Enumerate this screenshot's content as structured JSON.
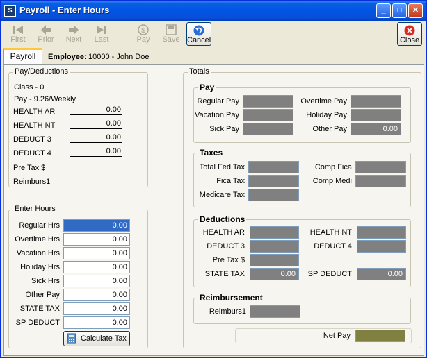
{
  "window": {
    "title": "Payroll - Enter Hours",
    "minimize": "_",
    "maximize": "□",
    "close": "✕"
  },
  "toolbar": {
    "first": "First",
    "prior": "Prior",
    "next": "Next",
    "last": "Last",
    "pay": "Pay",
    "save": "Save",
    "cancel": "Cancel",
    "close": "Close"
  },
  "tab": {
    "label": "Payroll"
  },
  "employee": {
    "label": "Employee:",
    "value": "10000 - John Doe"
  },
  "pay_deductions": {
    "title": "Pay/Deductions",
    "class": "Class - 0",
    "pay": "Pay - 9.26/Weekly",
    "rows": [
      {
        "label": "HEALTH AR",
        "value": "0.00"
      },
      {
        "label": "HEALTH NT",
        "value": "0.00"
      },
      {
        "label": "DEDUCT 3",
        "value": "0.00"
      },
      {
        "label": "DEDUCT 4",
        "value": "0.00"
      },
      {
        "label": "Pre Tax $",
        "value": ""
      },
      {
        "label": "Reimburs1",
        "value": ""
      }
    ]
  },
  "enter_hours": {
    "title": "Enter Hours",
    "rows": [
      {
        "label": "Regular Hrs",
        "value": "0.00"
      },
      {
        "label": "Overtime Hrs",
        "value": "0.00"
      },
      {
        "label": "Vacation Hrs",
        "value": "0.00"
      },
      {
        "label": "Holiday Hrs",
        "value": "0.00"
      },
      {
        "label": "Sick Hrs",
        "value": "0.00"
      },
      {
        "label": "Other Pay",
        "value": "0.00"
      },
      {
        "label": "STATE TAX",
        "value": "0.00"
      },
      {
        "label": "SP DEDUCT",
        "value": "0.00"
      }
    ],
    "calculate_label": "Calculate Tax"
  },
  "totals": {
    "title": "Totals",
    "pay": {
      "title": "Pay",
      "regular": {
        "label": "Regular Pay",
        "value": ""
      },
      "vacation": {
        "label": "Vacation Pay",
        "value": ""
      },
      "sick": {
        "label": "Sick Pay",
        "value": ""
      },
      "overtime": {
        "label": "Overtime Pay",
        "value": ""
      },
      "holiday": {
        "label": "Holiday Pay",
        "value": ""
      },
      "other": {
        "label": "Other Pay",
        "value": "0.00"
      }
    },
    "taxes": {
      "title": "Taxes",
      "fed": {
        "label": "Total Fed Tax",
        "value": ""
      },
      "fica": {
        "label": "Fica Tax",
        "value": ""
      },
      "medicare": {
        "label": "Medicare Tax",
        "value": ""
      },
      "comp_fica": {
        "label": "Comp Fica",
        "value": ""
      },
      "comp_medi": {
        "label": "Comp Medi",
        "value": ""
      }
    },
    "deductions": {
      "title": "Deductions",
      "health_ar": {
        "label": "HEALTH AR",
        "value": ""
      },
      "deduct3": {
        "label": "DEDUCT 3",
        "value": ""
      },
      "pretax": {
        "label": "Pre Tax $",
        "value": ""
      },
      "state_tax": {
        "label": "STATE TAX",
        "value": "0.00"
      },
      "health_nt": {
        "label": "HEALTH NT",
        "value": ""
      },
      "deduct4": {
        "label": "DEDUCT 4",
        "value": ""
      },
      "sp_deduct": {
        "label": "SP DEDUCT",
        "value": "0.00"
      }
    },
    "reimbursement": {
      "title": "Reimbursement",
      "reimburs1": {
        "label": "Reimburs1",
        "value": ""
      }
    },
    "net_pay": {
      "label": "Net Pay",
      "value": ""
    }
  },
  "colors": {
    "titlebar": "#0054e3",
    "readonly_field": "#808080",
    "net_pay_field": "#808040",
    "focused_field": "#316ac5"
  }
}
